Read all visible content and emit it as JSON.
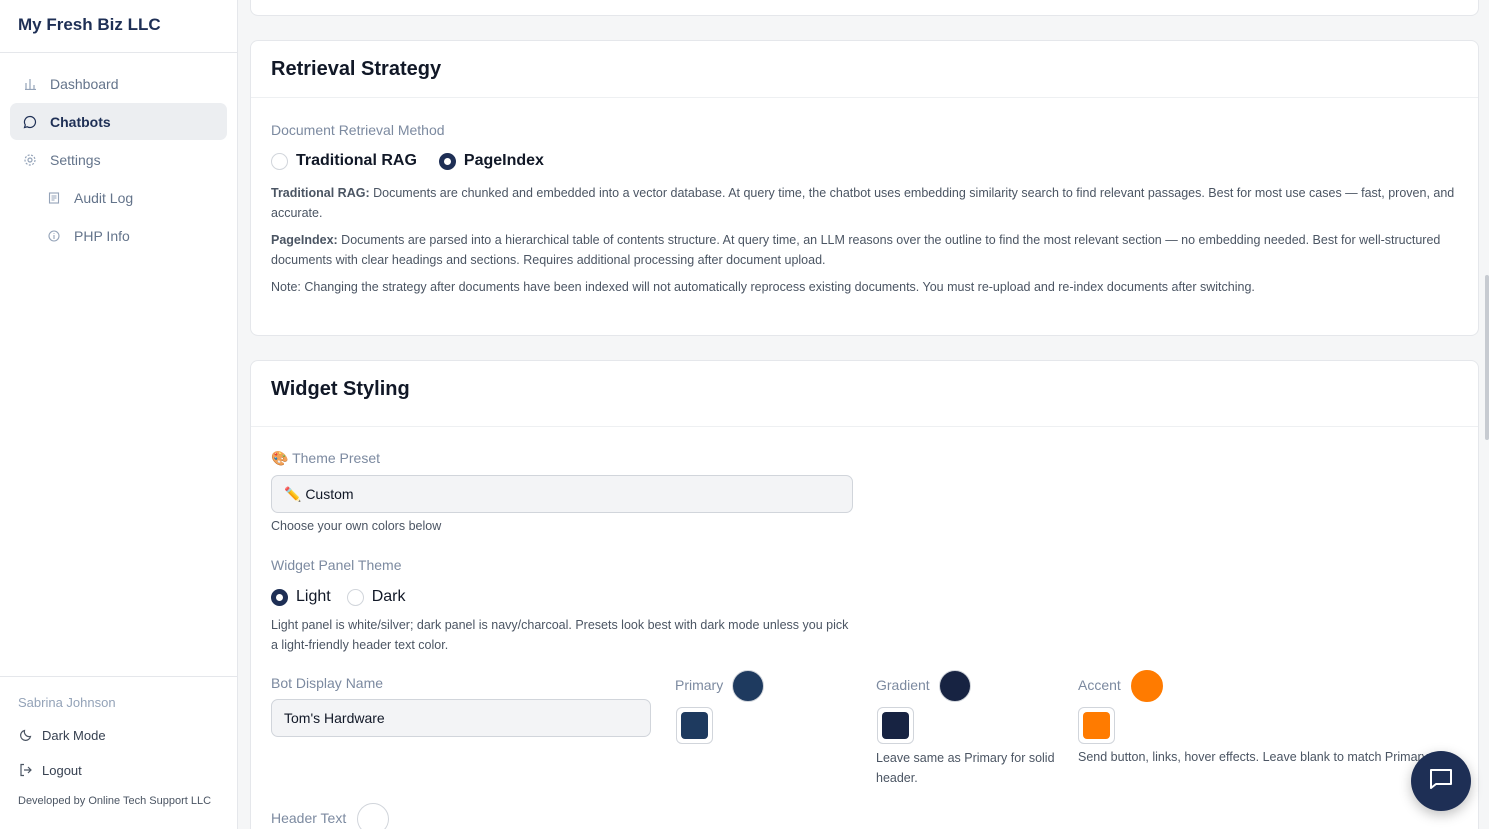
{
  "app": {
    "brand": "My Fresh Biz LLC"
  },
  "sidebar": {
    "items": [
      {
        "label": "Dashboard",
        "icon": "bar-chart-icon"
      },
      {
        "label": "Chatbots",
        "icon": "message-circle-icon",
        "active": true
      },
      {
        "label": "Settings",
        "icon": "gear-icon"
      },
      {
        "label": "Audit Log",
        "icon": "log-icon"
      },
      {
        "label": "PHP Info",
        "icon": "info-icon"
      }
    ],
    "user": "Sabrina Johnson",
    "dark_mode": "Dark Mode",
    "logout": "Logout",
    "developer": "Developed by Online Tech Support LLC"
  },
  "retrieval": {
    "title": "Retrieval Strategy",
    "method_label": "Document Retrieval Method",
    "options": [
      "Traditional RAG",
      "PageIndex"
    ],
    "selected": "PageIndex",
    "rag_title": "Traditional RAG:",
    "rag_desc": " Documents are chunked and embedded into a vector database. At query time, the chatbot uses embedding similarity search to find relevant passages. Best for most use cases — fast, proven, and accurate.",
    "pageindex_title": "PageIndex:",
    "pageindex_desc": " Documents are parsed into a hierarchical table of contents structure. At query time, an LLM reasons over the outline to find the most relevant section — no embedding needed. Best for well-structured documents with clear headings and sections. Requires additional processing after document upload.",
    "note": "Note: Changing the strategy after documents have been indexed will not automatically reprocess existing documents. You must re-upload and re-index documents after switching."
  },
  "styling": {
    "title": "Widget Styling",
    "theme_preset_label": "🎨 Theme Preset",
    "theme_preset_value": "✏️ Custom",
    "theme_preset_help": "Choose your own colors below",
    "panel_theme_label": "Widget Panel Theme",
    "panel_options": [
      "Light",
      "Dark"
    ],
    "panel_selected": "Light",
    "panel_help": "Light panel is white/silver; dark panel is navy/charcoal. Presets look best with dark mode unless you pick a light-friendly header text color.",
    "bot_name_label": "Bot Display Name",
    "bot_name_value": "Tom's Hardware",
    "primary_label": "Primary",
    "gradient_label": "Gradient",
    "gradient_help": "Leave same as Primary for solid header.",
    "accent_label": "Accent",
    "accent_help": "Send button, links, hover effects. Leave blank to match Primary.",
    "header_text_label": "Header Text"
  },
  "colors": {
    "primary": "#1e3a5f",
    "gradient": "#172342",
    "accent": "#ff7b00",
    "header_text": "#ffffff"
  }
}
